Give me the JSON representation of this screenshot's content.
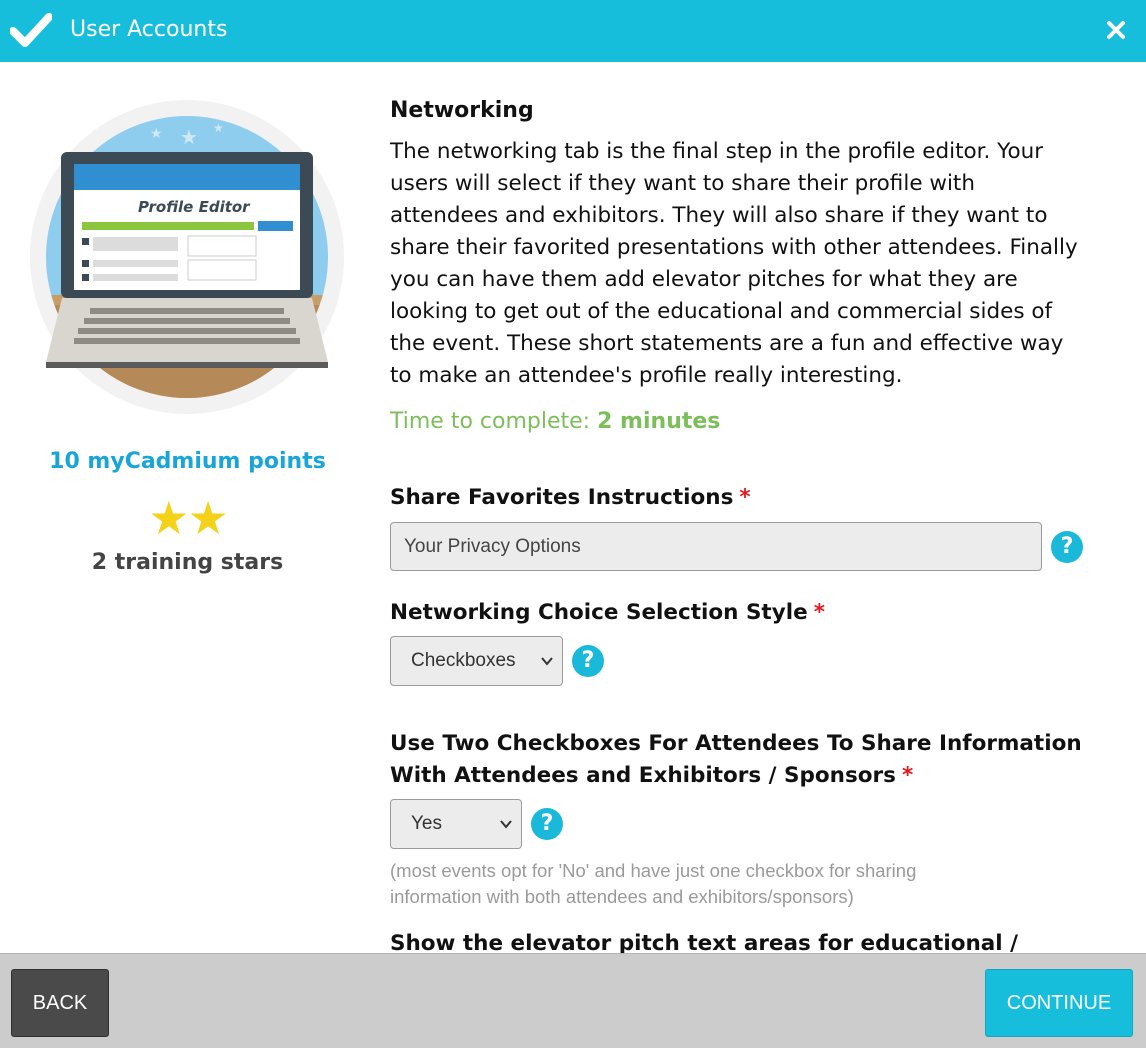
{
  "header": {
    "title": "User Accounts",
    "check_icon": "check-icon",
    "close_icon": "close-icon"
  },
  "sidebar": {
    "illustration_label": "Profile Editor",
    "points": "10 myCadmium points",
    "stars": "★★",
    "stars_count": 2,
    "stars_label": "2 training stars"
  },
  "main": {
    "section_title": "Networking",
    "description": "The networking tab is the final step in the profile editor. Your users will select if they want to share their profile with attendees and exhibitors. They will also share if they want to share their favorited presentations with other attendees. Finally you can have them add elevator pitches for what they are looking to get out of the educational and commercial sides of the event. These short statements are a fun and effective way to make an attendee's profile really interesting.",
    "time_label": "Time to complete:",
    "time_value": "2 minutes",
    "fields": {
      "share_favorites": {
        "label": "Share Favorites Instructions",
        "required": "*",
        "value": "Your Privacy Options",
        "help": "?"
      },
      "selection_style": {
        "label": "Networking Choice Selection Style",
        "required": "*",
        "value": "Checkboxes",
        "help": "?"
      },
      "two_checkboxes": {
        "label_line1": "Use Two Checkboxes For Attendees To Share Information",
        "label_line2": "With Attendees and Exhibitors / Sponsors",
        "required": "*",
        "value": "Yes",
        "help": "?",
        "hint_line1": "(most events opt for 'No' and have just one checkbox for sharing",
        "hint_line2": "information with both attendees and exhibitors/sponsors)"
      },
      "elevator_pitch": {
        "label": "Show the elevator pitch text areas for educational /"
      }
    }
  },
  "footer": {
    "back_label": "BACK",
    "continue_label": "CONTINUE"
  },
  "colors": {
    "accent": "#16bedc",
    "points": "#1aa5d8",
    "stars": "#f5d21a",
    "time": "#7cbf5a",
    "required": "#e0191e"
  }
}
